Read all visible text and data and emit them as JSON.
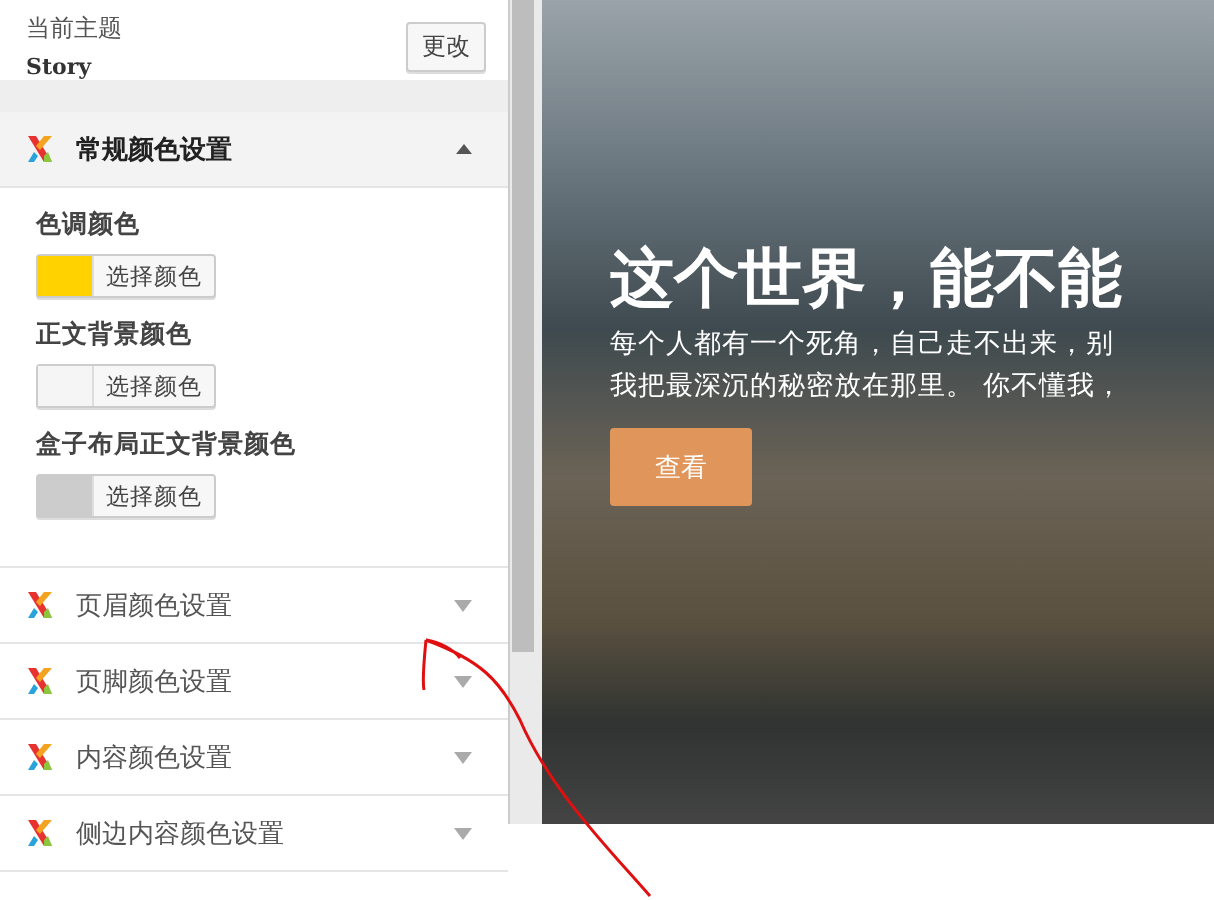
{
  "theme": {
    "label": "当前主题",
    "name": "Story",
    "change_button": "更改"
  },
  "sections": [
    {
      "title": "常规颜色设置",
      "expanded": true,
      "fields": [
        {
          "label": "色调颜色",
          "color": "#ffd200",
          "button": "选择颜色"
        },
        {
          "label": "正文背景颜色",
          "color": "#f5f5f5",
          "button": "选择颜色"
        },
        {
          "label": "盒子布局正文背景颜色",
          "color": "#cccccc",
          "button": "选择颜色"
        }
      ]
    },
    {
      "title": "页眉颜色设置",
      "expanded": false
    },
    {
      "title": "页脚颜色设置",
      "expanded": false
    },
    {
      "title": "内容颜色设置",
      "expanded": false
    },
    {
      "title": "侧边内容颜色设置",
      "expanded": false
    }
  ],
  "preview": {
    "title": "这个世界，能不能",
    "lines": [
      "每个人都有一个死角，自己走不出来，别",
      "我把最深沉的秘密放在那里。 你不懂我，"
    ],
    "button": "查看"
  }
}
